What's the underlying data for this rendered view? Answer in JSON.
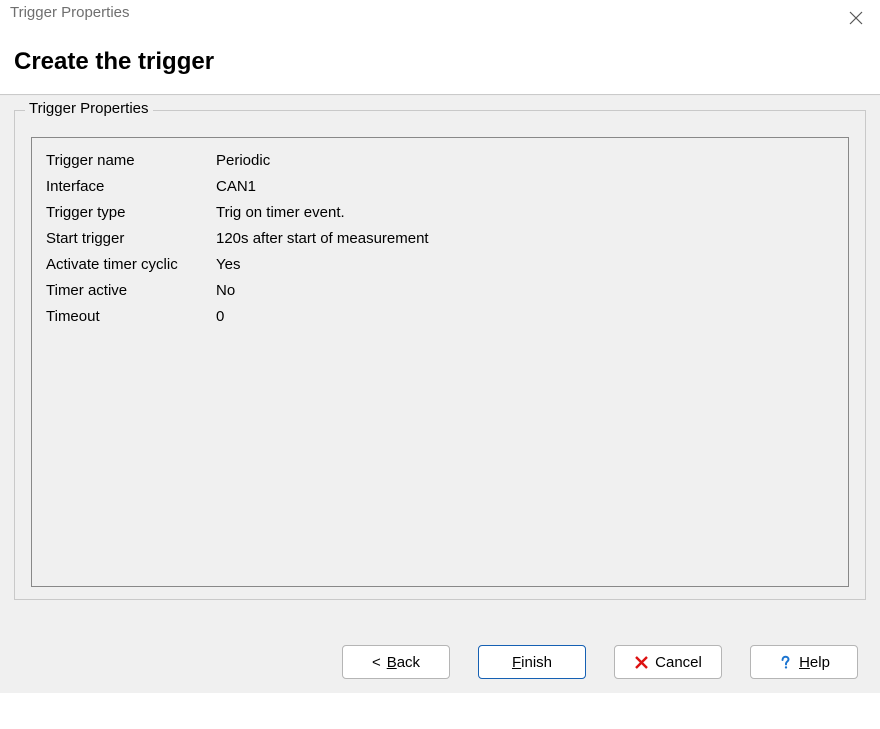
{
  "window": {
    "title": "Trigger Properties"
  },
  "header": {
    "heading": "Create the trigger"
  },
  "group": {
    "legend": "Trigger Properties"
  },
  "props": {
    "rows": [
      {
        "label": "Trigger name",
        "value": "Periodic"
      },
      {
        "label": "Interface",
        "value": "CAN1"
      },
      {
        "label": "Trigger type",
        "value": "Trig on timer event."
      },
      {
        "label": "Start trigger",
        "value": "120s after start of measurement"
      },
      {
        "label": "Activate timer cyclic",
        "value": "Yes"
      },
      {
        "label": "Timer active",
        "value": "No"
      },
      {
        "label": "Timeout",
        "value": "0"
      }
    ]
  },
  "buttons": {
    "back_prefix": "< ",
    "back": "Back",
    "finish": "Finish",
    "cancel": "Cancel",
    "help": "Help"
  }
}
